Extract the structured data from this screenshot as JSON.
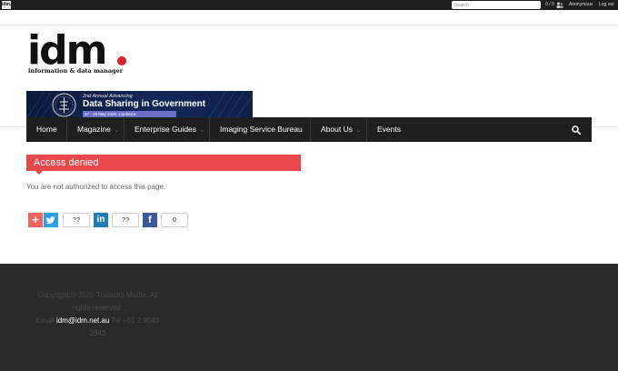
{
  "topbar": {
    "logo_text": "idm.",
    "search_placeholder": "Search",
    "counts": "0 / 0",
    "user": "Anonymous",
    "logout": "Log out"
  },
  "header": {
    "logo_main": "idm",
    "logo_tagline": "information & data manager"
  },
  "banner": {
    "line1": "2nd Annual Advancing",
    "line2": "Data Sharing in Government",
    "line3": "27 - 28 May 2020, Canberra"
  },
  "nav": {
    "items": [
      {
        "label": "Home",
        "has_dropdown": false
      },
      {
        "label": "Magazine",
        "has_dropdown": true
      },
      {
        "label": "Enterprise Guides",
        "has_dropdown": true
      },
      {
        "label": "Imaging Service Bureau",
        "has_dropdown": false
      },
      {
        "label": "About Us",
        "has_dropdown": true
      },
      {
        "label": "Events",
        "has_dropdown": false
      }
    ],
    "chevron": "⌄"
  },
  "content": {
    "title": "Access denied",
    "message": "You are not authorized to access this page."
  },
  "share": {
    "addthis": {
      "icon": "+",
      "color": "#f1645c"
    },
    "twitter": {
      "count": "??",
      "color": "#2b9fe5"
    },
    "linkedin": {
      "label": "in",
      "count": "??",
      "color": "#1e7bb8"
    },
    "facebook": {
      "label": "f",
      "count": "0",
      "color": "#3b5998"
    }
  },
  "footer": {
    "copyright": "Copyright © 2020 Transmit Media. All rights reserved.",
    "email_label": "Email",
    "email": "idm@idm.net.au",
    "tel": "Tel +61 2 9043 2943"
  }
}
